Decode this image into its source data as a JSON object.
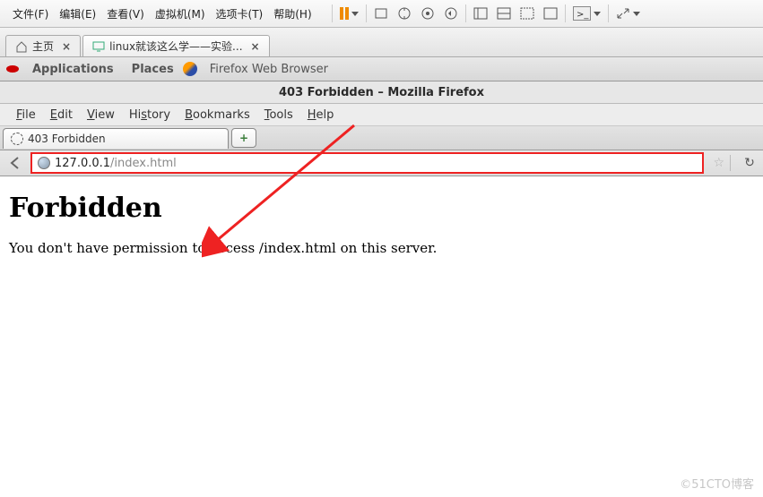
{
  "vm_menu": {
    "items": [
      "文件(F)",
      "编辑(E)",
      "查看(V)",
      "虚拟机(M)",
      "选项卡(T)",
      "帮助(H)"
    ]
  },
  "vm_tabs": {
    "home": "主页",
    "active": "linux就该这么学——实验..."
  },
  "gnome": {
    "apps": "Applications",
    "places": "Places",
    "ff": "Firefox Web Browser"
  },
  "firefox": {
    "window_title": "403 Forbidden – Mozilla Firefox",
    "menu": {
      "file": "File",
      "edit": "Edit",
      "view": "View",
      "history": "History",
      "bookmarks": "Bookmarks",
      "tools": "Tools",
      "help": "Help"
    },
    "tab_title": "403 Forbidden",
    "newtab_plus": "+",
    "url_host": "127.0.0.1",
    "url_path": "/index.html",
    "star": "☆",
    "reload": "↻"
  },
  "page": {
    "heading": "Forbidden",
    "body": "You don't have permission to access /index.html on this server."
  },
  "watermark": "©51CTO博客"
}
